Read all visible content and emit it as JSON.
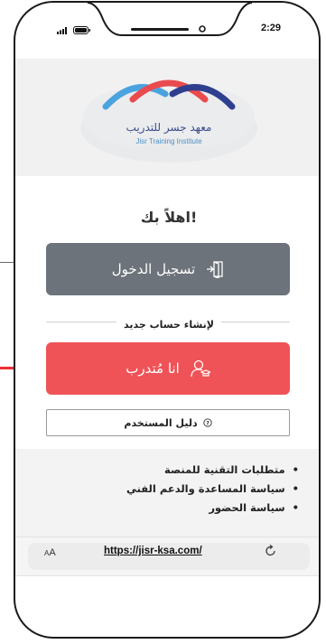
{
  "status": {
    "time": "2:29"
  },
  "logo": {
    "name_ar": "معهد جسر للتدريب",
    "name_en": "Jisr Training Institute"
  },
  "welcome": "اهلاً بك!",
  "login_button": "تسجيل الدخول",
  "create_account_label": "لإنشاء حساب جديد",
  "trainee_button": "انا مُتدرب",
  "user_guide_button": "دليل المستخدم",
  "policies": [
    "متطلبات التقنية للمنصة",
    "سياسة المساعدة والدعم الفني",
    "سياسة الحضور"
  ],
  "browser": {
    "text_size_label": "AA",
    "url": "https://jisr-ksa.com/"
  },
  "colors": {
    "login": "#6c737a",
    "trainee": "#ef5357",
    "pointer": "#ef2e32"
  }
}
